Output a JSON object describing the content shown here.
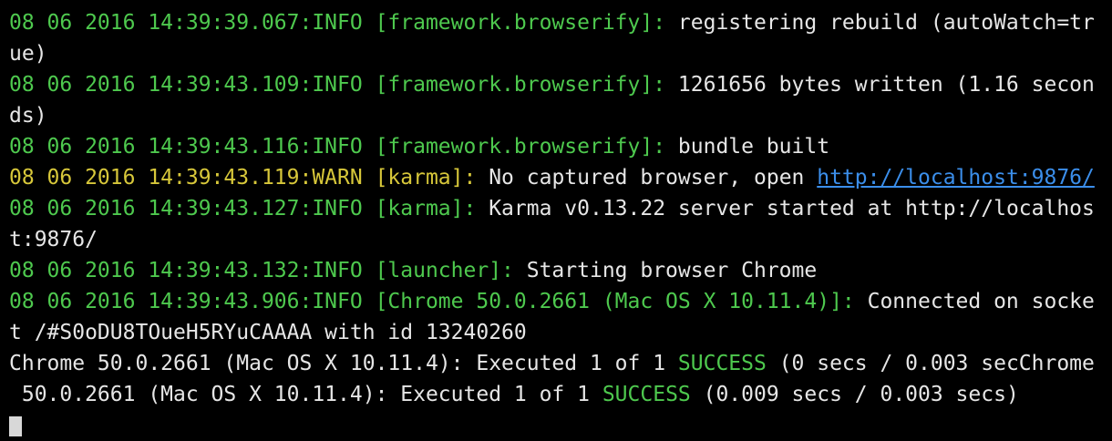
{
  "terminal": {
    "colors": {
      "background": "#000000",
      "info": "#4ec94e",
      "warn": "#d7c73a",
      "text": "#e6e6e6",
      "link": "#3b8eea"
    },
    "lines": [
      {
        "prefix": "08 06 2016 14:39:39.067:INFO [framework.browserify]:",
        "text": " registering rebuild (autoWatch=tr"
      },
      {
        "text": "ue)"
      },
      {
        "prefix": "08 06 2016 14:39:43.109:INFO [framework.browserify]:",
        "text": " 1261656 bytes written (1.16 secon"
      },
      {
        "text": "ds)"
      },
      {
        "prefix": "08 06 2016 14:39:43.116:INFO [framework.browserify]:",
        "text": " bundle built"
      },
      {
        "prefix": "08 06 2016 14:39:43.119:WARN [karma]:",
        "text": " No captured browser, open ",
        "link": "http://localhost:9876/"
      },
      {
        "prefix": "08 06 2016 14:39:43.127:INFO [karma]:",
        "text": " Karma v0.13.22 server started at http://localhos"
      },
      {
        "text": "t:9876/"
      },
      {
        "prefix": "08 06 2016 14:39:43.132:INFO [launcher]:",
        "text": " Starting browser Chrome"
      },
      {
        "prefix": "08 06 2016 14:39:43.906:INFO [Chrome 50.0.2661 (Mac OS X 10.11.4)]:",
        "text": " Connected on socke"
      },
      {
        "text": "t /#S0oDU8TOueH5RYuCAAAA with id 13240260"
      },
      {
        "a": "Chrome 50.0.2661 (Mac OS X 10.11.4): Executed 1 of 1 ",
        "status": "SUCCESS",
        "b": " (0 secs / 0.003 secChrome"
      },
      {
        "a": " 50.0.2661 (Mac OS X 10.11.4): Executed 1 of 1 ",
        "status": "SUCCESS",
        "b": " (0.009 secs / 0.003 secs)"
      }
    ]
  }
}
